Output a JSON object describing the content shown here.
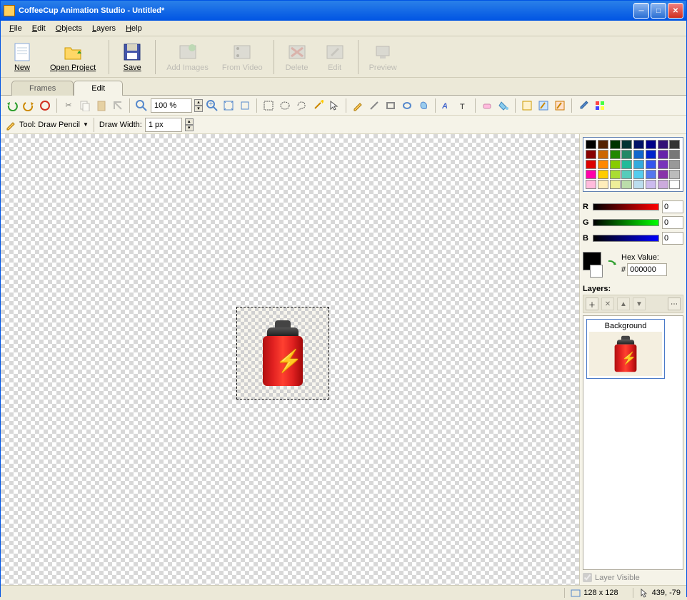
{
  "window": {
    "title": "CoffeeCup Animation Studio - Untitled*"
  },
  "menubar": {
    "file": "File",
    "edit": "Edit",
    "objects": "Objects",
    "layers": "Layers",
    "help": "Help"
  },
  "toolbar": {
    "new": "New",
    "open": "Open Project",
    "save": "Save",
    "addimg": "Add Images",
    "fromvid": "From Video",
    "delete": "Delete",
    "edit": "Edit",
    "preview": "Preview"
  },
  "tabs": {
    "frames": "Frames",
    "edit": "Edit"
  },
  "zoom": "100 %",
  "tool": {
    "label": "Tool: Draw Pencil",
    "widthlabel": "Draw Width:",
    "widthval": "1 px"
  },
  "palette": [
    "#000000",
    "#552200",
    "#003300",
    "#003333",
    "#001166",
    "#000088",
    "#331177",
    "#333333",
    "#880000",
    "#cc6600",
    "#228800",
    "#228866",
    "#1166cc",
    "#0022cc",
    "#6622aa",
    "#777777",
    "#dd0000",
    "#ff8800",
    "#88cc00",
    "#22bb99",
    "#33aadd",
    "#3355ee",
    "#7733bb",
    "#999999",
    "#ff00aa",
    "#ffcc00",
    "#aadd33",
    "#55ccbb",
    "#55ccee",
    "#5577ee",
    "#8833aa",
    "#bbbbbb",
    "#ffbbdd",
    "#ffeebb",
    "#eeee99",
    "#bbddaa",
    "#bbddee",
    "#ccbbee",
    "#ccaadd",
    "#ffffff"
  ],
  "rgb": {
    "r": "0",
    "g": "0",
    "b": "0",
    "rlbl": "R",
    "glbl": "G",
    "blbl": "B"
  },
  "hex": {
    "label": "Hex Value:",
    "hash": "#",
    "value": "000000"
  },
  "layers": {
    "header": "Layers:",
    "bg": "Background",
    "visible": "Layer Visible"
  },
  "status": {
    "dims": "128 x 128",
    "coords": "439, -79"
  }
}
